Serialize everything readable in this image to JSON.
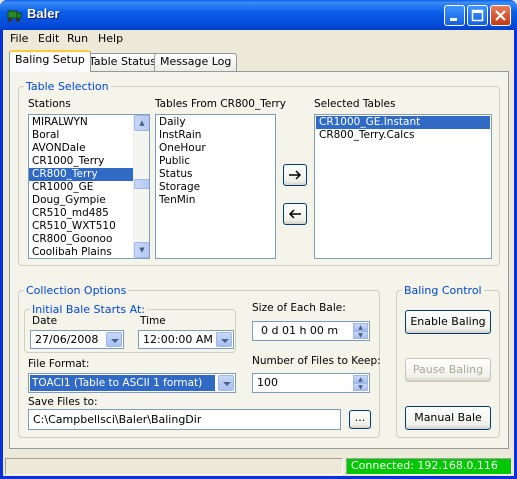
{
  "window": {
    "title": "Baler"
  },
  "menu": [
    {
      "label": "File"
    },
    {
      "label": "Edit"
    },
    {
      "label": "Run"
    },
    {
      "label": "Help"
    }
  ],
  "tabs": [
    {
      "label": "Baling Setup"
    },
    {
      "label": "Table Status"
    },
    {
      "label": "Message Log"
    }
  ],
  "table_selection": {
    "legend": "Table Selection",
    "stations_label": "Stations",
    "stations": [
      "MIRALWYN",
      "Boral",
      "AVONDale",
      "CR1000_Terry",
      "CR800_Terry",
      "CR1000_GE",
      "Doug_Gympie",
      "CR510_md485",
      "CR510_WXT510",
      "CR800_Goonoo",
      "Coolibah Plains"
    ],
    "selected_station": "CR800_Terry",
    "tables_label": "Tables From CR800_Terry",
    "tables": [
      "Daily",
      "InstRain",
      "OneHour",
      "Public",
      "Status",
      "Storage",
      "TenMin"
    ],
    "selected_label": "Selected Tables",
    "selected_tables": [
      "CR1000_GE.Instant",
      "CR800_Terry.Calcs"
    ],
    "highlighted_selected": "CR1000_GE.Instant"
  },
  "collection": {
    "legend": "Collection Options",
    "initial_legend": "Initial Bale Starts At:",
    "date_label": "Date",
    "date_value": "27/06/2008",
    "time_label": "Time",
    "time_value": "12:00:00 AM",
    "size_label": "Size of Each Bale:",
    "size_value": "0 d 01 h 00 m",
    "format_label": "File Format:",
    "format_value": "TOACI1 (Table to ASCII 1 format)",
    "files_keep_label": "Number of Files to Keep:",
    "files_keep_value": "100",
    "save_label": "Save Files to:",
    "save_value": "C:\\Campbellsci\\Baler\\BalingDir",
    "browse_label": "..."
  },
  "baling_control": {
    "legend": "Baling Control",
    "enable_label": "Enable Baling",
    "pause_label": "Pause Baling",
    "manual_label": "Manual Bale"
  },
  "status": {
    "connection": "Connected: 192.168.0.116"
  }
}
